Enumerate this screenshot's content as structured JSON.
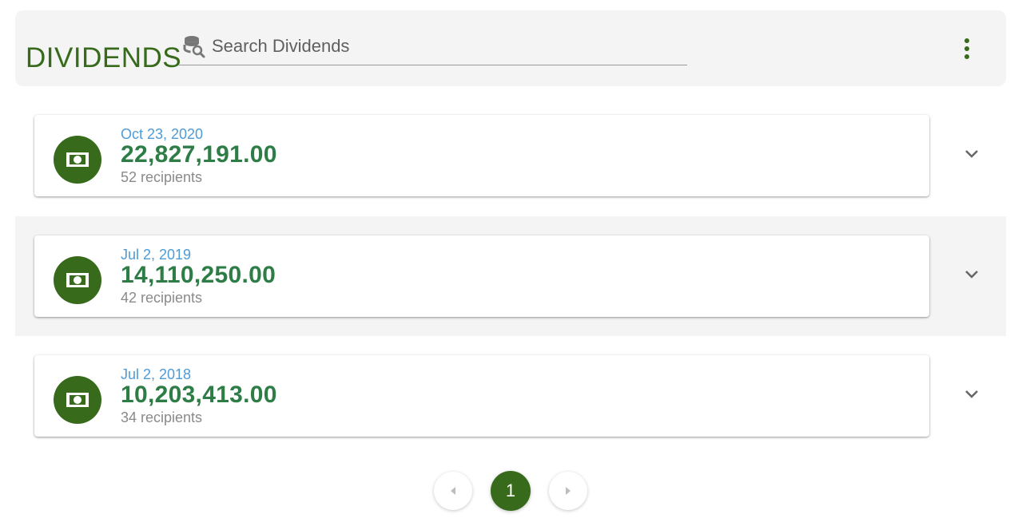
{
  "header": {
    "title": "DIVIDENDS",
    "search": {
      "placeholder": "Search Dividends",
      "value": ""
    },
    "menu_icon": "more-vert-icon"
  },
  "dividends": [
    {
      "date": "Oct 23, 2020",
      "amount": "22,827,191.00",
      "recipients": "52 recipients",
      "icon": "money-icon"
    },
    {
      "date": "Jul 2, 2019",
      "amount": "14,110,250.00",
      "recipients": "42 recipients",
      "icon": "money-icon"
    },
    {
      "date": "Jul 2, 2018",
      "amount": "10,203,413.00",
      "recipients": "34 recipients",
      "icon": "money-icon"
    }
  ],
  "pagination": {
    "current_page": "1"
  },
  "colors": {
    "brand_green": "#376b1b",
    "amount_green": "#2e7d46",
    "date_blue": "#4f9bd6",
    "panel_gray": "#f4f4f4"
  }
}
